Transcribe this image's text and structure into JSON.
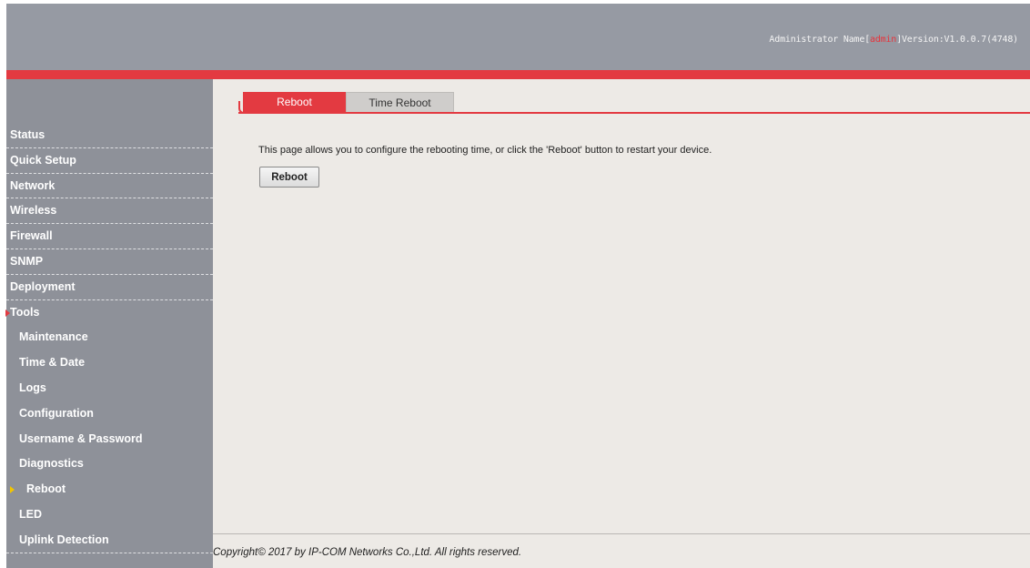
{
  "header": {
    "admin_prefix": "Administrator Name[",
    "admin_user": "admin",
    "version_text": "]Version:V1.0.0.7(4748)"
  },
  "colors": {
    "accent": "#e33a41",
    "header_bg": "#969aa3",
    "sidebar_bg": "#8e9199",
    "content_bg": "#edeae6"
  },
  "sidebar": {
    "items": [
      {
        "label": "Status"
      },
      {
        "label": "Quick Setup"
      },
      {
        "label": "Network"
      },
      {
        "label": "Wireless"
      },
      {
        "label": "Firewall"
      },
      {
        "label": "SNMP"
      },
      {
        "label": "Deployment"
      },
      {
        "label": "Tools",
        "expanded": true
      }
    ],
    "sub_items": [
      {
        "label": "Maintenance"
      },
      {
        "label": "Time & Date"
      },
      {
        "label": "Logs"
      },
      {
        "label": "Configuration"
      },
      {
        "label": "Username & Password"
      },
      {
        "label": "Diagnostics"
      },
      {
        "label": "Reboot",
        "active": true
      },
      {
        "label": "LED"
      },
      {
        "label": "Uplink Detection"
      }
    ]
  },
  "tabs": [
    {
      "label": "Reboot",
      "active": true
    },
    {
      "label": "Time Reboot",
      "active": false
    }
  ],
  "content": {
    "description": "This page allows you to configure the rebooting time, or click the 'Reboot' button to restart your device.",
    "reboot_button": "Reboot"
  },
  "footer": {
    "copyright": "Copyright© 2017 by IP-COM Networks Co.,Ltd. All rights reserved."
  }
}
